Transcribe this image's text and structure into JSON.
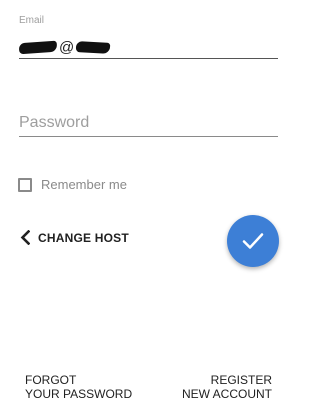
{
  "email": {
    "label": "Email",
    "value_at": "@"
  },
  "password": {
    "placeholder": "Password",
    "value": ""
  },
  "remember": {
    "label": "Remember me",
    "checked": false
  },
  "change_host": {
    "label": "CHANGE HOST",
    "icon": "chevron-left-icon"
  },
  "submit": {
    "icon": "checkmark-icon",
    "color": "#3d7fd6"
  },
  "links": {
    "forgot_line1": "FORGOT",
    "forgot_line2": "YOUR PASSWORD",
    "register_line1": "REGISTER",
    "register_line2": "NEW ACCOUNT"
  }
}
